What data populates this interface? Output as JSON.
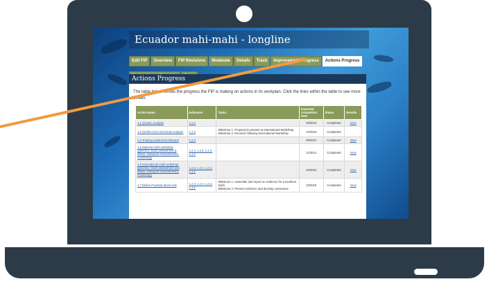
{
  "site": {
    "title": "Ecuador mahi-mahi - longline"
  },
  "tabs": [
    "Edit FIP",
    "Overview",
    "FIP Revisions",
    "Moderate",
    "Details",
    "Track",
    "Improvement Progress",
    "Actions Progress",
    "Red Indicator Progress",
    "Grant"
  ],
  "active_tab": "Actions Progress",
  "panel": {
    "title": "Actions Progress",
    "intro": "The table below shows the progress the FIP is making on actions in its workplan. Click the links within the table to see more details."
  },
  "table": {
    "headers": {
      "action": "Action Name",
      "indicators": "Indicators",
      "tasks": "Tasks",
      "date": "Expected Completion Date",
      "status": "Status",
      "results": "Results"
    },
    "rows": [
      {
        "action": "1.1 Genetic Analysis",
        "indicators": "1.2.3",
        "tasks": "",
        "date": "03/2013",
        "status": "Completed",
        "results": "View"
      },
      {
        "action": "1.5 Otolith micro-elemental analysis",
        "indicators": "1.2.3",
        "tasks": "Milestone 1: Proposal to present at International Workshop\nMilestone 2: Decision following International Workshop",
        "date": "12/2016",
        "status": "Completed",
        "results": ""
      },
      {
        "action": "1.4 Training national technicians",
        "indicators": "1.2.3",
        "tasks": "",
        "date": "03/2012",
        "status": "Completed",
        "results": "View"
      },
      {
        "action": "1.6 National mahi workshop (genetics, stock assessment & status, biological characteristics, monitoring)",
        "indicators": "1.2.4, 1.2.2, 1.2.3, 1.1.1",
        "tasks": "",
        "date": "11/2012",
        "status": "Completed",
        "results": "View"
      },
      {
        "action": "1.8 International mahi workshop (genetics, stock assessment and status, biological characteristics, monitoring)",
        "indicators": "1.2.4, 1.2.2, 1.2.3, 1.1.1",
        "tasks": "",
        "date": "10/2015",
        "status": "Completed",
        "results": "View"
      },
      {
        "action": "1.7 Define Practical Stock Unit",
        "indicators": "1.2.4, 1.2.2, 1.2.3, 1.1.1",
        "tasks": "Milestone 1: Assemble and report on evidence for a southern stock\nMilestone 2: Present evidence and develop consensus",
        "date": "10/2015",
        "status": "Completed",
        "results": "View"
      }
    ]
  },
  "colors": {
    "frame": "#2d3b48",
    "tab": "#8a9a5b",
    "header": "#1b3a5b",
    "pointer": "#f39a3c",
    "link": "#2a5fa8"
  }
}
